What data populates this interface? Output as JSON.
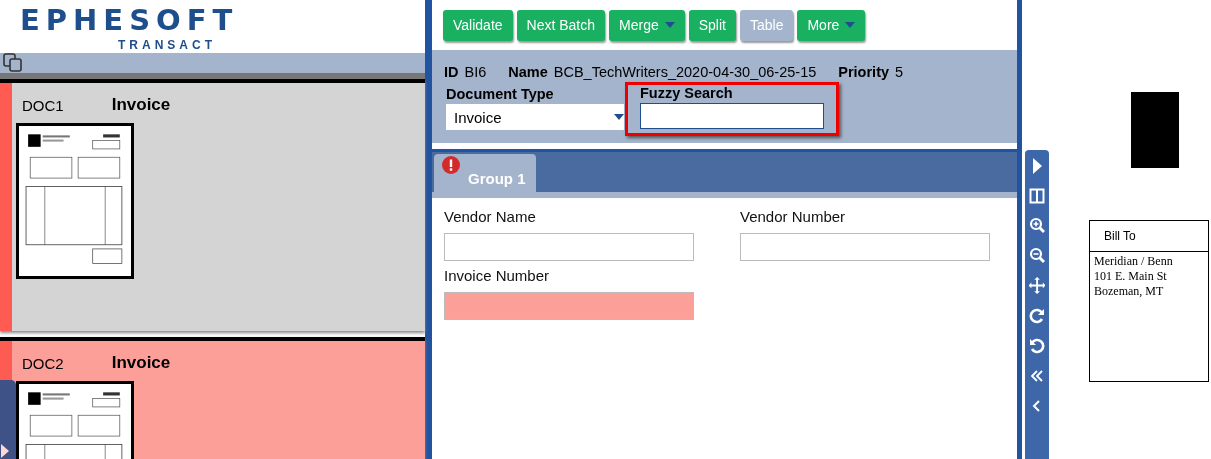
{
  "logo": {
    "name": "EPHESOFT",
    "subtitle": "TRANSACT"
  },
  "documents": [
    {
      "id": "DOC1",
      "type": "Invoice",
      "invalid": false
    },
    {
      "id": "DOC2",
      "type": "Invoice",
      "invalid": true
    }
  ],
  "toolbar": [
    {
      "label": "Validate",
      "disabled": false,
      "dropdown": false
    },
    {
      "label": "Next Batch",
      "disabled": false,
      "dropdown": false
    },
    {
      "label": "Merge",
      "disabled": false,
      "dropdown": true
    },
    {
      "label": "Split",
      "disabled": false,
      "dropdown": false
    },
    {
      "label": "Table",
      "disabled": true,
      "dropdown": false
    },
    {
      "label": "More",
      "disabled": false,
      "dropdown": true
    }
  ],
  "batch": {
    "id_label": "ID",
    "id": "BI6",
    "name_label": "Name",
    "name": "BCB_TechWriters_2020-04-30_06-25-15",
    "priority_label": "Priority",
    "priority": "5"
  },
  "document_type": {
    "label": "Document Type",
    "value": "Invoice"
  },
  "fuzzy_search": {
    "label": "Fuzzy Search",
    "highlighted": true
  },
  "tabs": [
    {
      "label": "Group 1",
      "selected": true,
      "error": true
    }
  ],
  "fields": [
    {
      "label": "Vendor Name",
      "invalid": false
    },
    {
      "label": "Vendor Number",
      "invalid": false
    },
    {
      "label": "Invoice Number",
      "invalid": true
    }
  ],
  "document_preview": {
    "bill_to": "Bill To",
    "lines": [
      "Meridian / Benn",
      "101 E. Main St",
      "Bozeman, MT"
    ]
  }
}
